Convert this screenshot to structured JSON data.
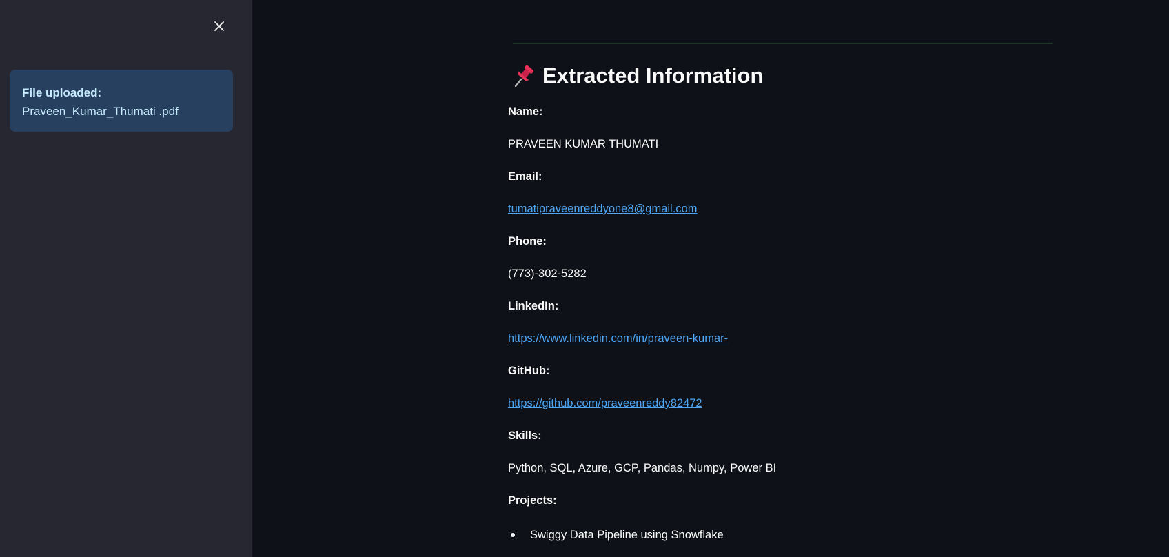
{
  "sidebar": {
    "close_icon": "close-icon",
    "alert": {
      "title": "File uploaded:",
      "filename": "Praveen_Kumar_Thumati .pdf"
    }
  },
  "main": {
    "heading_icon": "pushpin-icon",
    "heading": "Extracted Information",
    "fields": {
      "name_label": "Name:",
      "name_value": "PRAVEEN KUMAR THUMATI",
      "email_label": "Email:",
      "email_value": "tumatipraveenreddyone8@gmail.com",
      "phone_label": "Phone:",
      "phone_value": "(773)-302-5282",
      "linkedin_label": "LinkedIn:",
      "linkedin_value": "https://www.linkedin.com/in/praveen-kumar-",
      "github_label": "GitHub:",
      "github_value": "https://github.com/praveenreddy82472",
      "skills_label": "Skills:",
      "skills_value": "Python, SQL, Azure, GCP, Pandas, Numpy, Power BI",
      "projects_label": "Projects:",
      "projects": [
        "Swiggy Data Pipeline using Snowflake"
      ]
    }
  },
  "colors": {
    "background": "#0e1117",
    "sidebar": "#262730",
    "alert_background": "#28405f",
    "alert_text": "#c7ebff",
    "link": "#4ea6f5",
    "text": "#fafafa",
    "pin": "#e8325a"
  }
}
